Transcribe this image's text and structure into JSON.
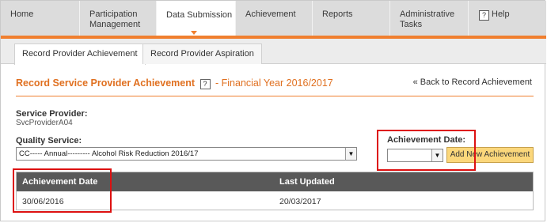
{
  "nav": {
    "items": [
      {
        "label": "Home"
      },
      {
        "label": "Participation\nManagement"
      },
      {
        "label": "Data Submission"
      },
      {
        "label": "Achievement"
      },
      {
        "label": "Reports"
      },
      {
        "label": "Administrative\nTasks"
      },
      {
        "label": "Help",
        "icon": "question-box-icon"
      }
    ],
    "active": "Data Submission"
  },
  "subtabs": {
    "items": [
      {
        "label": "Record Provider Achievement"
      },
      {
        "label": "Record Provider Aspiration"
      }
    ],
    "active": "Record Provider Achievement"
  },
  "page": {
    "title": "Record Service Provider Achievement",
    "help_glyph": "?",
    "financial_year": "- Financial Year 2016/2017",
    "back_link": "« Back to Record Achievement"
  },
  "form": {
    "service_provider_label": "Service Provider:",
    "service_provider_value": "SvcProviderA04",
    "quality_service_label": "Quality Service:",
    "quality_service_value": "CC----- Annual--------- Alcohol Risk Reduction 2016/17",
    "achievement_date_label": "Achievement Date:",
    "achievement_date_value": "",
    "add_button": "Add New Achievement",
    "dropdown_glyph": "▼"
  },
  "table": {
    "columns": [
      "Achievement Date",
      "Last Updated"
    ],
    "rows": [
      [
        "30/06/2016",
        "20/03/2017"
      ]
    ]
  },
  "colors": {
    "accent": "#f07f2f",
    "title": "#e07020",
    "header_bg": "#595959",
    "highlight": "#d11111"
  }
}
